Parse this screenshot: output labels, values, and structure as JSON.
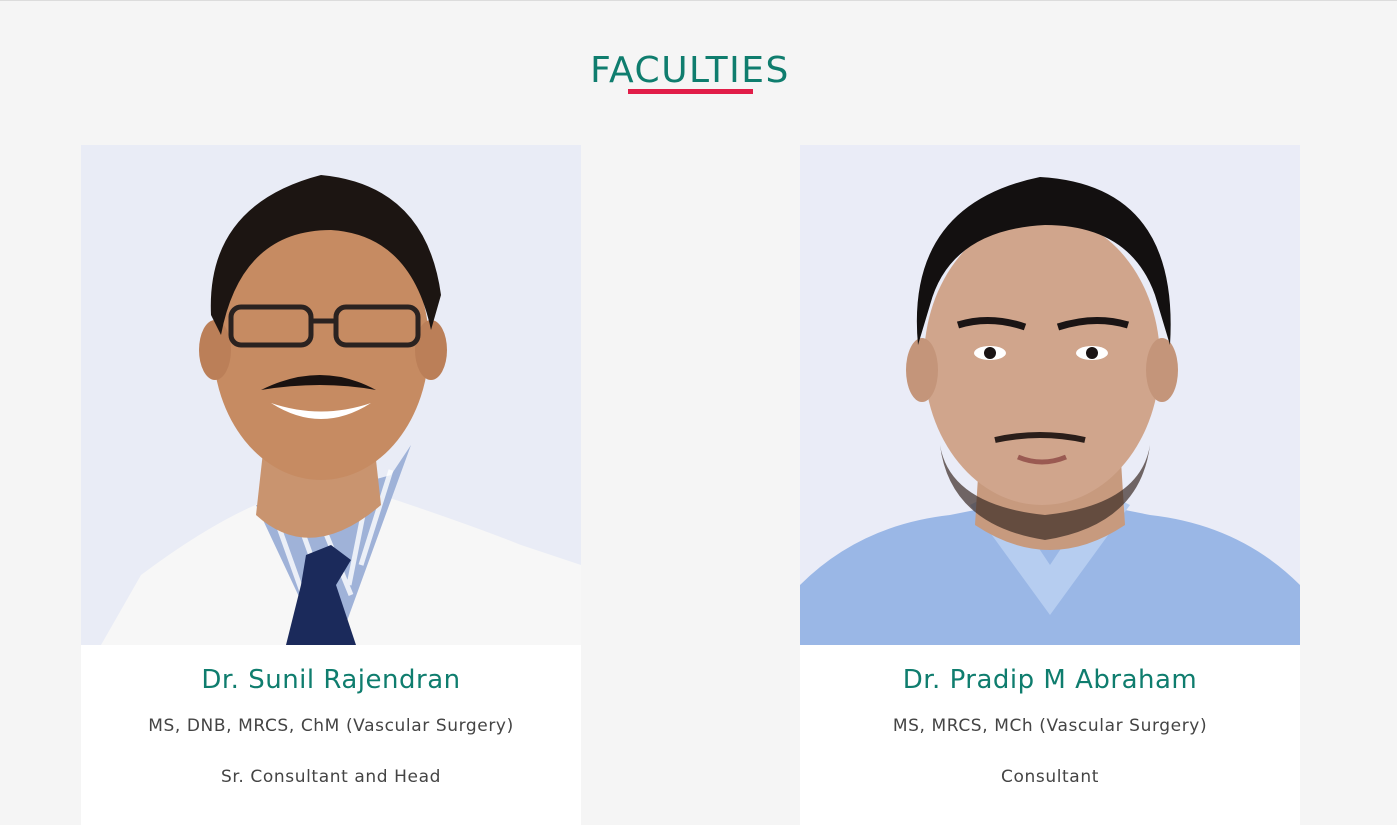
{
  "section": {
    "title": "FACULTIES",
    "accent_color": "#e11d48",
    "title_color": "#0f7d6e"
  },
  "faculty": [
    {
      "name": "Dr. Sunil Rajendran",
      "qualifications": "MS, DNB, MRCS, ChM (Vascular Surgery)",
      "role": "Sr. Consultant and Head",
      "photo_icon": "doctor-portrait-glasses-white-coat"
    },
    {
      "name": "Dr. Pradip M Abraham",
      "qualifications": "MS, MRCS, MCh (Vascular Surgery)",
      "role": "Consultant",
      "photo_icon": "doctor-portrait-blue-shirt"
    }
  ]
}
